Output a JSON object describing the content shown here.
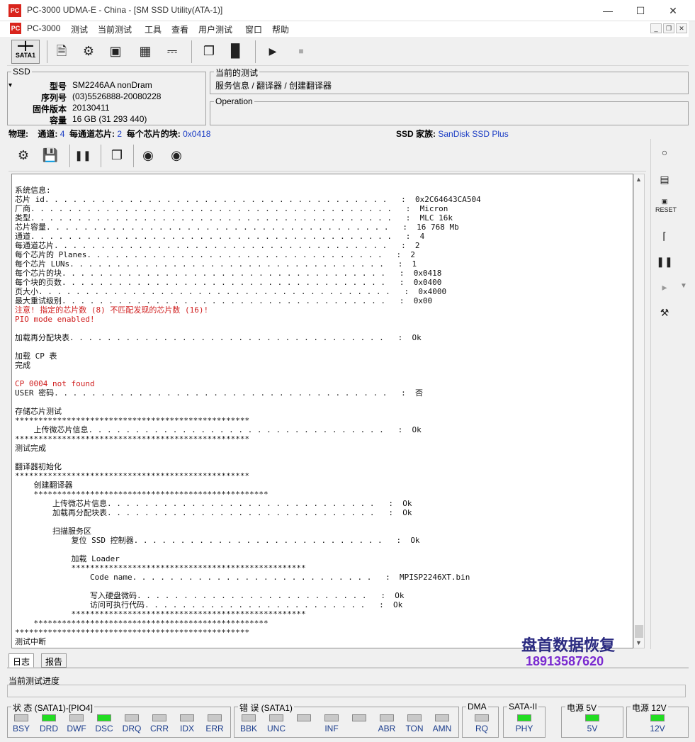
{
  "window": {
    "title": "PC-3000 UDMA-E - China - [SM SSD Utility(ATA-1)]",
    "logo": "PC"
  },
  "menu": [
    "PC-3000",
    "测试",
    "当前测试",
    "工具",
    "查看",
    "用户测试",
    "窗口",
    "帮助"
  ],
  "toolbar": {
    "sata_label": "SATA1"
  },
  "ssd": {
    "legend": "SSD",
    "model_label": "型号",
    "model": "SM2246AA nonDram",
    "serial_label": "序列号",
    "serial": "(03)5526888-20080228",
    "firmware_label": "固件版本",
    "firmware": "20130411",
    "capacity_label": "容量",
    "capacity": "16 GB (31 293 440)"
  },
  "current_test": {
    "legend": "当前的测试",
    "path": "服务信息 / 翻译器 / 创建翻译器"
  },
  "operation": {
    "legend": "Operation"
  },
  "physical": {
    "label": "物理:",
    "channels_label": "通道:",
    "channels": "4",
    "chips_label": "每通道芯片:",
    "chips": "2",
    "blocks_label": "每个芯片的块:",
    "blocks": "0x0418",
    "family_label": "SSD 家族:",
    "family": "SanDisk SSD Plus"
  },
  "sidebar": {
    "reset_label": "RESET"
  },
  "log": {
    "lines": [
      {
        "t": "系统信息:"
      },
      {
        "t": "芯片 id. . . . . . . . . . . . . . . . . . . . . . . . . . . . . . . . . . . . .   :  0x2C64643CA504"
      },
      {
        "t": "厂商. . . . . . . . . . . . . . . . . . . . . . . . . . . . . . . . . . . . . . .   :  Micron"
      },
      {
        "t": "类型. . . . . . . . . . . . . . . . . . . . . . . . . . . . . . . . . . . . . . .   :  MLC 16k"
      },
      {
        "t": "芯片容量. . . . . . . . . . . . . . . . . . . . . . . . . . . . . . . . . . . . .   :  16 768 Mb"
      },
      {
        "t": "通道. . . . . . . . . . . . . . . . . . . . . . . . . . . . . . . . . . . . . . .   :  4"
      },
      {
        "t": "每通道芯片. . . . . . . . . . . . . . . . . . . . . . . . . . . . . . . . . . . .   :  2"
      },
      {
        "t": "每个芯片的 Planes. . . . . . . . . . . . . . . . . . . . . . . . . . . . . . . .   :  2"
      },
      {
        "t": "每个芯片 LUNs. . . . . . . . . . . . . . . . . . . . . . . . . . . . . . . . . .   :  1"
      },
      {
        "t": "每个芯片的块. . . . . . . . . . . . . . . . . . . . . . . . . . . . . . . . . . .   :  0x0418"
      },
      {
        "t": "每个块的页数. . . . . . . . . . . . . . . . . . . . . . . . . . . . . . . . . . .   :  0x0400"
      },
      {
        "t": "页大小. . . . . . . . . . . . . . . . . . . . . . . . . . . . . . . . . . . . . .   :  0x4000"
      },
      {
        "t": "最大重试级别. . . . . . . . . . . . . . . . . . . . . . . . . . . . . . . . . . .   :  0x00"
      },
      {
        "t": "注意! 指定的芯片数 (8) 不匹配发现的芯片数 (16)!",
        "c": "#d02020"
      },
      {
        "t": "PIO mode enabled!",
        "c": "#d02020"
      },
      {
        "t": ""
      },
      {
        "t": "加载再分配块表. . . . . . . . . . . . . . . . . . . . . . . . . . . . . . . . . .   :  Ok"
      },
      {
        "t": ""
      },
      {
        "t": "加载 CP 表"
      },
      {
        "t": "完成"
      },
      {
        "t": ""
      },
      {
        "t": "CP 0004 not found",
        "c": "#d02020"
      },
      {
        "t": "USER 密码. . . . . . . . . . . . . . . . . . . . . . . . . . . . . . . . . . . .   :  否"
      },
      {
        "t": ""
      },
      {
        "t": "存储芯片测试"
      },
      {
        "t": "**************************************************"
      },
      {
        "t": "    上传微芯片信息. . . . . . . . . . . . . . . . . . . . . . . . . . . . . . . .   :  Ok"
      },
      {
        "t": "**************************************************"
      },
      {
        "t": "测试完成"
      },
      {
        "t": ""
      },
      {
        "t": "翻译器初始化"
      },
      {
        "t": "**************************************************"
      },
      {
        "t": "    创建翻译器"
      },
      {
        "t": "    **************************************************"
      },
      {
        "t": "        上传微芯片信息. . . . . . . . . . . . . . . . . . . . . . . . . . . . .   :  Ok"
      },
      {
        "t": "        加载再分配块表. . . . . . . . . . . . . . . . . . . . . . . . . . . . .   :  Ok"
      },
      {
        "t": ""
      },
      {
        "t": "        扫描服务区"
      },
      {
        "t": "            复位 SSD 控制器. . . . . . . . . . . . . . . . . . . . . . . . . . .   :  Ok"
      },
      {
        "t": ""
      },
      {
        "t": "            加载 Loader"
      },
      {
        "t": "            **************************************************"
      },
      {
        "t": "                Code name. . . . . . . . . . . . . . . . . . . . . . . . . .   :  MPISP2246XT.bin"
      },
      {
        "t": ""
      },
      {
        "t": "                写入硬盘微码. . . . . . . . . . . . . . . . . . . . . . . . .   :  Ok"
      },
      {
        "t": "                访问可执行代码. . . . . . . . . . . . . . . . . . . . . . . .   :  Ok"
      },
      {
        "t": "            **************************************************"
      },
      {
        "t": "    **************************************************"
      },
      {
        "t": "**************************************************"
      },
      {
        "t": "测试中断"
      }
    ]
  },
  "watermark": {
    "name": "盘首数据恢复",
    "phone": "18913587620"
  },
  "tabs": {
    "log": "日志",
    "report": "报告"
  },
  "progress": {
    "label": "当前测试进度"
  },
  "status": {
    "state_legend": "状 态 (SATA1)-[PIO4]",
    "state": [
      {
        "l": "BSY",
        "on": false
      },
      {
        "l": "DRD",
        "on": true
      },
      {
        "l": "DWF",
        "on": false
      },
      {
        "l": "DSC",
        "on": true
      },
      {
        "l": "DRQ",
        "on": false
      },
      {
        "l": "CRR",
        "on": false
      },
      {
        "l": "IDX",
        "on": false
      },
      {
        "l": "ERR",
        "on": false
      }
    ],
    "error_legend": "错 误 (SATA1)",
    "errors": [
      {
        "l": "BBK",
        "on": false
      },
      {
        "l": "UNC",
        "on": false
      },
      {
        "l": "",
        "on": false
      },
      {
        "l": "INF",
        "on": false
      },
      {
        "l": "",
        "on": false
      },
      {
        "l": "ABR",
        "on": false
      },
      {
        "l": "TON",
        "on": false
      },
      {
        "l": "AMN",
        "on": false
      }
    ],
    "dma_legend": "DMA",
    "dma": {
      "l": "RQ",
      "on": false
    },
    "sata_legend": "SATA-II",
    "sata": {
      "l": "PHY",
      "on": true
    },
    "p5_legend": "电源 5V",
    "p5": {
      "l": "5V",
      "on": true
    },
    "p12_legend": "电源 12V",
    "p12": {
      "l": "12V",
      "on": true
    }
  }
}
